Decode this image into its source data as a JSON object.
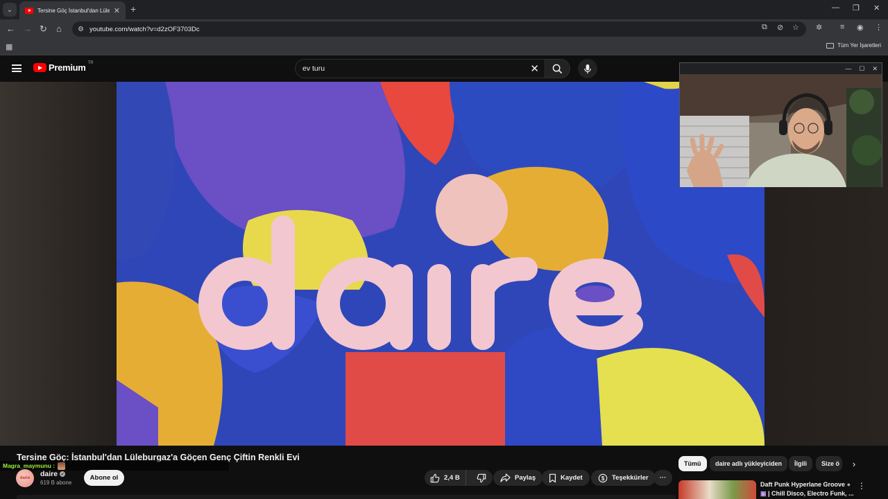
{
  "browser": {
    "tab_title": "Tersine Göç İstanbul'dan Lüleb",
    "url": "youtube.com/watch?v=d2zOF3703Dc",
    "bookmarks_folder": "Tüm Yer İşaretleri"
  },
  "masthead": {
    "logo_text": "Premium",
    "logo_region": "TR",
    "search_query": "ev turu"
  },
  "video": {
    "thumbnail_word": "daire",
    "title": "Tersine Göç: İstanbul'dan Lüleburgaz'a Göçen Genç Çiftin Renkli Evi"
  },
  "chat_overlay": {
    "user": "Magra_maymunu :"
  },
  "channel": {
    "avatar_text": "daire",
    "name": "daire",
    "subscribers": "619 B abone",
    "subscribe_label": "Abone ol"
  },
  "actions": {
    "likes": "2,4 B",
    "share": "Paylaş",
    "save": "Kaydet",
    "thanks": "Teşekkürler",
    "more": "···"
  },
  "chips": [
    "Tümü",
    "daire adlı yükleyiciden",
    "İlgili",
    "Size ö"
  ],
  "recommendation": {
    "title": "Daft Punk Hyperlane Groove",
    "subtitle": "| Chill Disco, Electro Funk, ..."
  },
  "colors": {
    "yt_red": "#ff0000",
    "chat_green": "#9cf03b"
  }
}
